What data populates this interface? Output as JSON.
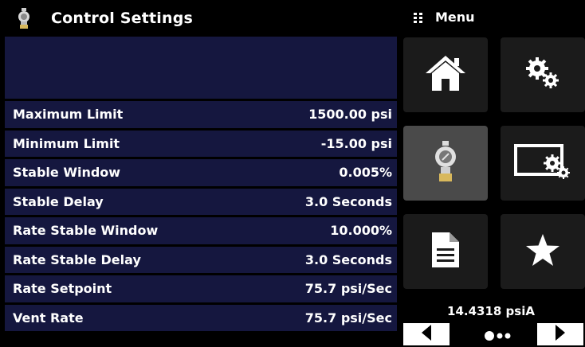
{
  "header": {
    "title": "Control Settings",
    "icon": "regulator-icon"
  },
  "settings": [
    {
      "label": "Maximum Limit",
      "value": "1500.00 psi"
    },
    {
      "label": "Minimum Limit",
      "value": "-15.00 psi"
    },
    {
      "label": "Stable Window",
      "value": "0.005%"
    },
    {
      "label": "Stable Delay",
      "value": "3.0 Seconds"
    },
    {
      "label": "Rate Stable Window",
      "value": "10.000%"
    },
    {
      "label": "Rate Stable Delay",
      "value": "3.0 Seconds"
    },
    {
      "label": "Rate Setpoint",
      "value": "75.7 psi/Sec"
    },
    {
      "label": "Vent Rate",
      "value": "75.7 psi/Sec"
    }
  ],
  "menu": {
    "title": "Menu",
    "tiles": [
      {
        "name": "home",
        "icon": "home-icon",
        "active": false
      },
      {
        "name": "settings",
        "icon": "gears-icon",
        "active": false
      },
      {
        "name": "control",
        "icon": "regulator-icon",
        "active": true
      },
      {
        "name": "display-settings",
        "icon": "monitor-gears-icon",
        "active": false
      },
      {
        "name": "documents",
        "icon": "document-icon",
        "active": false
      },
      {
        "name": "favorites",
        "icon": "star-icon",
        "active": false
      }
    ]
  },
  "status": {
    "pressure": "14.4318 psiA"
  },
  "pager": {
    "pages": 3,
    "current": 1
  },
  "colors": {
    "row_bg": "#15173f",
    "tile_bg": "#1b1b1b",
    "tile_active": "#4a4a4a"
  }
}
